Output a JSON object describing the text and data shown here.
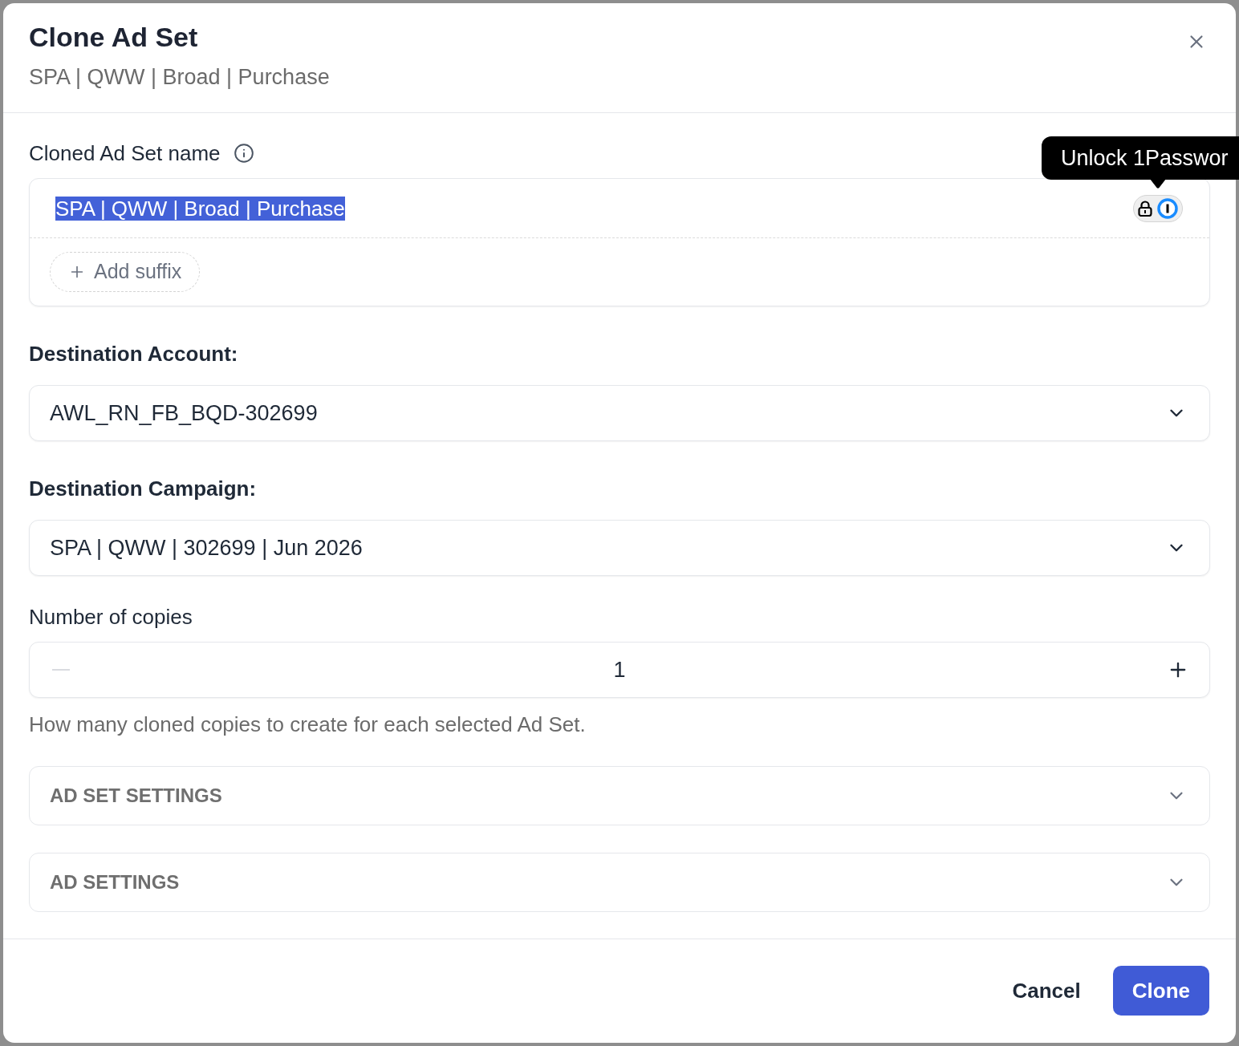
{
  "dialog": {
    "title": "Clone Ad Set",
    "subtitle": "SPA | QWW | Broad | Purchase"
  },
  "name_field": {
    "label": "Cloned Ad Set name",
    "value": "SPA | QWW | Broad | Purchase",
    "text_highlighted": true,
    "add_suffix": "Add suffix"
  },
  "password_tooltip": {
    "text": "Unlock 1Passwor"
  },
  "destination_account": {
    "label": "Destination Account:",
    "value": "AWL_RN_FB_BQD-302699"
  },
  "destination_campaign": {
    "label": "Destination Campaign:",
    "value": "SPA | QWW | 302699 | Jun 2026"
  },
  "copies": {
    "label": "Number of copies",
    "value": "1",
    "decrement_disabled": true,
    "hint": "How many cloned copies to create for each selected Ad Set."
  },
  "sections": [
    {
      "title": "AD SET SETTINGS",
      "expanded": false
    },
    {
      "title": "AD SETTINGS",
      "expanded": false
    }
  ],
  "buttons": [
    {
      "label": "Cancel",
      "kind": "secondary"
    },
    {
      "label": "Clone",
      "kind": "primary"
    }
  ]
}
